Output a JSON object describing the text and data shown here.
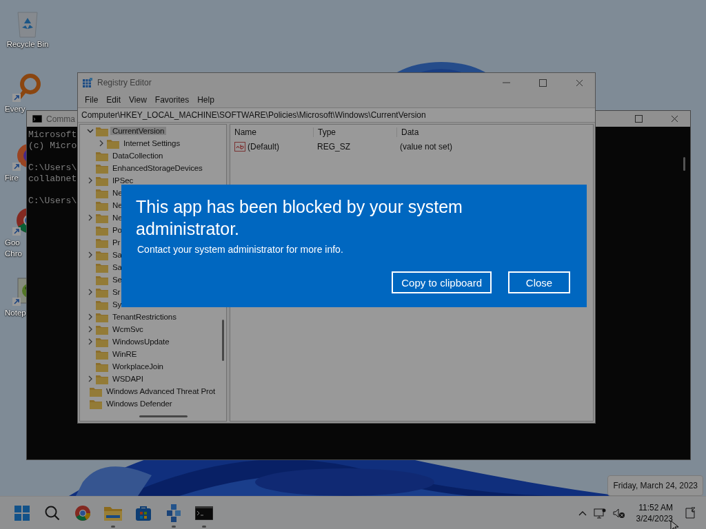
{
  "desktop_icons": [
    {
      "kind": "recycle-bin",
      "lines": [
        "Recycle Bin"
      ]
    },
    {
      "kind": "magnifier",
      "lines": [
        "Every"
      ]
    },
    {
      "kind": "firefox",
      "lines": [
        "Fire"
      ]
    },
    {
      "kind": "chrome",
      "lines": [
        "Goo",
        "Chro"
      ]
    },
    {
      "kind": "notepad",
      "lines": [
        "Notep"
      ]
    }
  ],
  "command_prompt": {
    "title": "Comma",
    "paragraphs": [
      [
        "Microsoft",
        "(c) Micro"
      ],
      [
        "C:\\Users\\",
        "collabnet"
      ],
      [
        "C:\\Users\\"
      ]
    ]
  },
  "registry_editor": {
    "title": "Registry Editor",
    "menu": [
      "File",
      "Edit",
      "View",
      "Favorites",
      "Help"
    ],
    "address": "Computer\\HKEY_LOCAL_MACHINE\\SOFTWARE\\Policies\\Microsoft\\Windows\\CurrentVersion",
    "tree": {
      "items": [
        {
          "label": "CurrentVersion",
          "selected": true,
          "expanded": true,
          "children": [
            {
              "label": "Internet Settings",
              "selected": false,
              "expanded": false
            }
          ]
        },
        {
          "label": "DataCollection",
          "selected": false
        },
        {
          "label": "EnhancedStorageDevices",
          "selected": false
        },
        {
          "label": "IPSec",
          "selected": false,
          "expanded": false
        },
        {
          "label": "Ne",
          "selected": false
        },
        {
          "label": "Ne",
          "selected": false
        },
        {
          "label": "Ne",
          "selected": false,
          "expanded": false
        },
        {
          "label": "Po",
          "selected": false
        },
        {
          "label": "Pr",
          "selected": false
        },
        {
          "label": "Sa",
          "selected": false,
          "expanded": false
        },
        {
          "label": "Sa",
          "selected": false
        },
        {
          "label": "Se",
          "selected": false
        },
        {
          "label": "Sr",
          "selected": false,
          "expanded": false
        },
        {
          "label": "Sy",
          "selected": false
        },
        {
          "label": "TenantRestrictions",
          "selected": false,
          "expanded": false
        },
        {
          "label": "WcmSvc",
          "selected": false,
          "expanded": false
        },
        {
          "label": "WindowsUpdate",
          "selected": false,
          "expanded": false
        },
        {
          "label": "WinRE",
          "selected": false
        },
        {
          "label": "WorkplaceJoin",
          "selected": false
        },
        {
          "label": "WSDAPI",
          "selected": false,
          "expanded": false
        }
      ],
      "outer_items": [
        {
          "label": "Windows Advanced Threat Prot",
          "selected": false
        },
        {
          "label": "Windows Defender",
          "selected": false
        }
      ]
    },
    "columns": [
      "Name",
      "Type",
      "Data"
    ],
    "values": [
      {
        "name": "(Default)",
        "type": "REG_SZ",
        "data": "(value not set)"
      }
    ]
  },
  "dialog": {
    "title": "This app has been blocked by your system administrator.",
    "message": "Contact your system administrator for more info.",
    "buttons": [
      "Copy to clipboard",
      "Close"
    ]
  },
  "date_tooltip": "Friday, March 24, 2023",
  "taskbar": {
    "apps": [
      {
        "kind": "start",
        "running": false
      },
      {
        "kind": "search",
        "running": false
      },
      {
        "kind": "chrome",
        "running": false
      },
      {
        "kind": "folder",
        "running": true
      },
      {
        "kind": "store",
        "running": false
      },
      {
        "kind": "cubes",
        "running": true
      },
      {
        "kind": "terminal",
        "running": true
      }
    ],
    "time": "11:52 AM",
    "date": "3/24/2023"
  }
}
